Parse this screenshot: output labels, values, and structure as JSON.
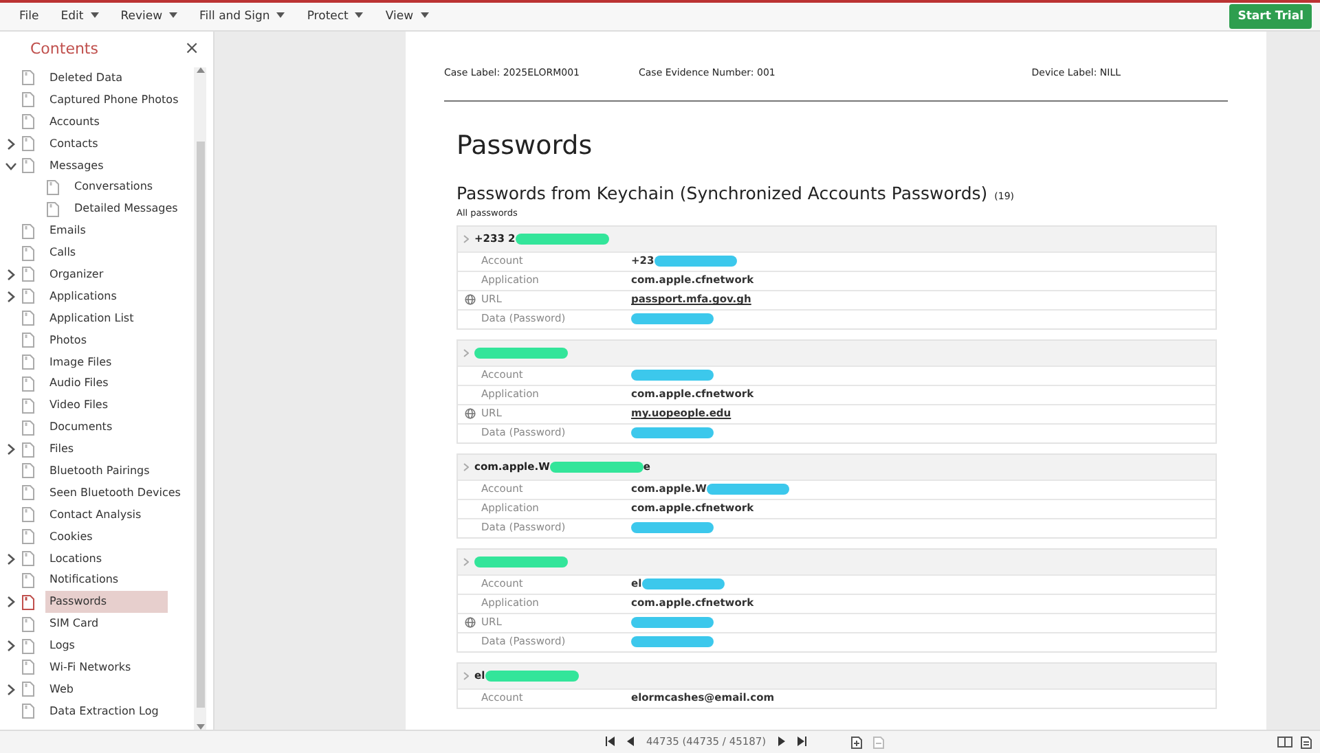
{
  "menu": [
    {
      "label": "File",
      "dropdown": false
    },
    {
      "label": "Edit",
      "dropdown": true
    },
    {
      "label": "Review",
      "dropdown": true
    },
    {
      "label": "Fill and Sign",
      "dropdown": true
    },
    {
      "label": "Protect",
      "dropdown": true
    },
    {
      "label": "View",
      "dropdown": true
    }
  ],
  "trial_button": "Start Trial",
  "sidebar": {
    "title": "Contents",
    "close": "×",
    "items": [
      {
        "label": "Deleted Data",
        "kind": "leaf",
        "selected": false
      },
      {
        "label": "Captured Phone Photos",
        "kind": "leaf",
        "selected": false
      },
      {
        "label": "Accounts",
        "kind": "leaf",
        "selected": false
      },
      {
        "label": "Contacts",
        "kind": "folder",
        "expanded": false,
        "selected": false
      },
      {
        "label": "Messages",
        "kind": "folder",
        "expanded": true,
        "selected": false,
        "children": [
          {
            "label": "Conversations",
            "kind": "leaf",
            "selected": false
          },
          {
            "label": "Detailed Messages",
            "kind": "leaf",
            "selected": false
          }
        ]
      },
      {
        "label": "Emails",
        "kind": "leaf",
        "selected": false
      },
      {
        "label": "Calls",
        "kind": "leaf",
        "selected": false
      },
      {
        "label": "Organizer",
        "kind": "folder",
        "expanded": false,
        "selected": false
      },
      {
        "label": "Applications",
        "kind": "folder",
        "expanded": false,
        "selected": false
      },
      {
        "label": "Application List",
        "kind": "leaf",
        "selected": false
      },
      {
        "label": "Photos",
        "kind": "leaf",
        "selected": false
      },
      {
        "label": "Image Files",
        "kind": "leaf",
        "selected": false
      },
      {
        "label": "Audio Files",
        "kind": "leaf",
        "selected": false
      },
      {
        "label": "Video Files",
        "kind": "leaf",
        "selected": false
      },
      {
        "label": "Documents",
        "kind": "leaf",
        "selected": false
      },
      {
        "label": "Files",
        "kind": "folder",
        "expanded": false,
        "selected": false
      },
      {
        "label": "Bluetooth Pairings",
        "kind": "leaf",
        "selected": false
      },
      {
        "label": "Seen Bluetooth Devices",
        "kind": "leaf",
        "selected": false
      },
      {
        "label": "Contact Analysis",
        "kind": "leaf",
        "selected": false
      },
      {
        "label": "Cookies",
        "kind": "leaf",
        "selected": false
      },
      {
        "label": "Locations",
        "kind": "folder",
        "expanded": false,
        "selected": false
      },
      {
        "label": "Notifications",
        "kind": "leaf",
        "selected": false
      },
      {
        "label": "Passwords",
        "kind": "folder",
        "expanded": false,
        "selected": true
      },
      {
        "label": "SIM Card",
        "kind": "leaf",
        "selected": false
      },
      {
        "label": "Logs",
        "kind": "folder",
        "expanded": false,
        "selected": false
      },
      {
        "label": "Wi-Fi Networks",
        "kind": "leaf",
        "selected": false
      },
      {
        "label": "Web",
        "kind": "folder",
        "expanded": false,
        "selected": false
      },
      {
        "label": "Data Extraction Log",
        "kind": "leaf",
        "selected": false
      }
    ]
  },
  "report": {
    "header": [
      "Case Label: 2025ELORM001",
      "Case Evidence Number: 001",
      "Device Label: NILL"
    ],
    "title": "Passwords",
    "section_title": "Passwords from Keychain (Synchronized Accounts Passwords)",
    "section_count": "(19)",
    "section_subtitle": "All passwords",
    "entries": [
      {
        "title": [
          {
            "kind": "text",
            "text": "+233 2"
          },
          {
            "kind": "redaction",
            "color": "#33e59a"
          }
        ],
        "rows": [
          {
            "label": "Account",
            "link": false,
            "value": [
              {
                "kind": "text",
                "text": "+23"
              },
              {
                "kind": "redaction",
                "color": "#3cc8ec"
              }
            ]
          },
          {
            "label": "Application",
            "link": false,
            "value": [
              {
                "kind": "text",
                "text": "com.apple.cfnetwork"
              }
            ]
          },
          {
            "label": "URL",
            "link": true,
            "value": [
              {
                "kind": "text",
                "text": "passport.mfa.gov.gh"
              }
            ]
          },
          {
            "label": "Data (Password)",
            "link": false,
            "value": [
              {
                "kind": "redaction",
                "color": "#3cc8ec"
              }
            ]
          }
        ]
      },
      {
        "title": [
          {
            "kind": "redaction",
            "color": "#33e59a"
          }
        ],
        "rows": [
          {
            "label": "Account",
            "link": false,
            "value": [
              {
                "kind": "redaction",
                "color": "#3cc8ec"
              }
            ]
          },
          {
            "label": "Application",
            "link": false,
            "value": [
              {
                "kind": "text",
                "text": "com.apple.cfnetwork"
              }
            ]
          },
          {
            "label": "URL",
            "link": true,
            "value": [
              {
                "kind": "text",
                "text": "my.uopeople.edu"
              }
            ]
          },
          {
            "label": "Data (Password)",
            "link": false,
            "value": [
              {
                "kind": "redaction",
                "color": "#3cc8ec"
              }
            ]
          }
        ]
      },
      {
        "title": [
          {
            "kind": "text",
            "text": "com.apple.W"
          },
          {
            "kind": "redaction",
            "color": "#33e59a"
          },
          {
            "kind": "text",
            "text": "e"
          }
        ],
        "rows": [
          {
            "label": "Account",
            "link": false,
            "value": [
              {
                "kind": "text",
                "text": "com.apple.W"
              },
              {
                "kind": "redaction",
                "color": "#3cc8ec"
              }
            ]
          },
          {
            "label": "Application",
            "link": false,
            "value": [
              {
                "kind": "text",
                "text": "com.apple.cfnetwork"
              }
            ]
          },
          {
            "label": "Data (Password)",
            "link": false,
            "value": [
              {
                "kind": "redaction",
                "color": "#3cc8ec"
              }
            ]
          }
        ]
      },
      {
        "title": [
          {
            "kind": "redaction",
            "color": "#33e59a"
          }
        ],
        "rows": [
          {
            "label": "Account",
            "link": false,
            "value": [
              {
                "kind": "text",
                "text": "el"
              },
              {
                "kind": "redaction",
                "color": "#3cc8ec"
              }
            ]
          },
          {
            "label": "Application",
            "link": false,
            "value": [
              {
                "kind": "text",
                "text": "com.apple.cfnetwork"
              }
            ]
          },
          {
            "label": "URL",
            "link": true,
            "value": [
              {
                "kind": "redaction",
                "color": "#3cc8ec"
              }
            ]
          },
          {
            "label": "Data (Password)",
            "link": false,
            "value": [
              {
                "kind": "redaction",
                "color": "#3cc8ec"
              }
            ]
          }
        ]
      },
      {
        "title": [
          {
            "kind": "text",
            "text": "el"
          },
          {
            "kind": "redaction",
            "color": "#33e59a"
          }
        ],
        "rows": [
          {
            "label": "Account",
            "link": false,
            "value": [
              {
                "kind": "text",
                "text": "elormcashes@email.com"
              }
            ]
          }
        ]
      }
    ]
  },
  "pager": {
    "position": "44735 (44735 / 45187)"
  }
}
